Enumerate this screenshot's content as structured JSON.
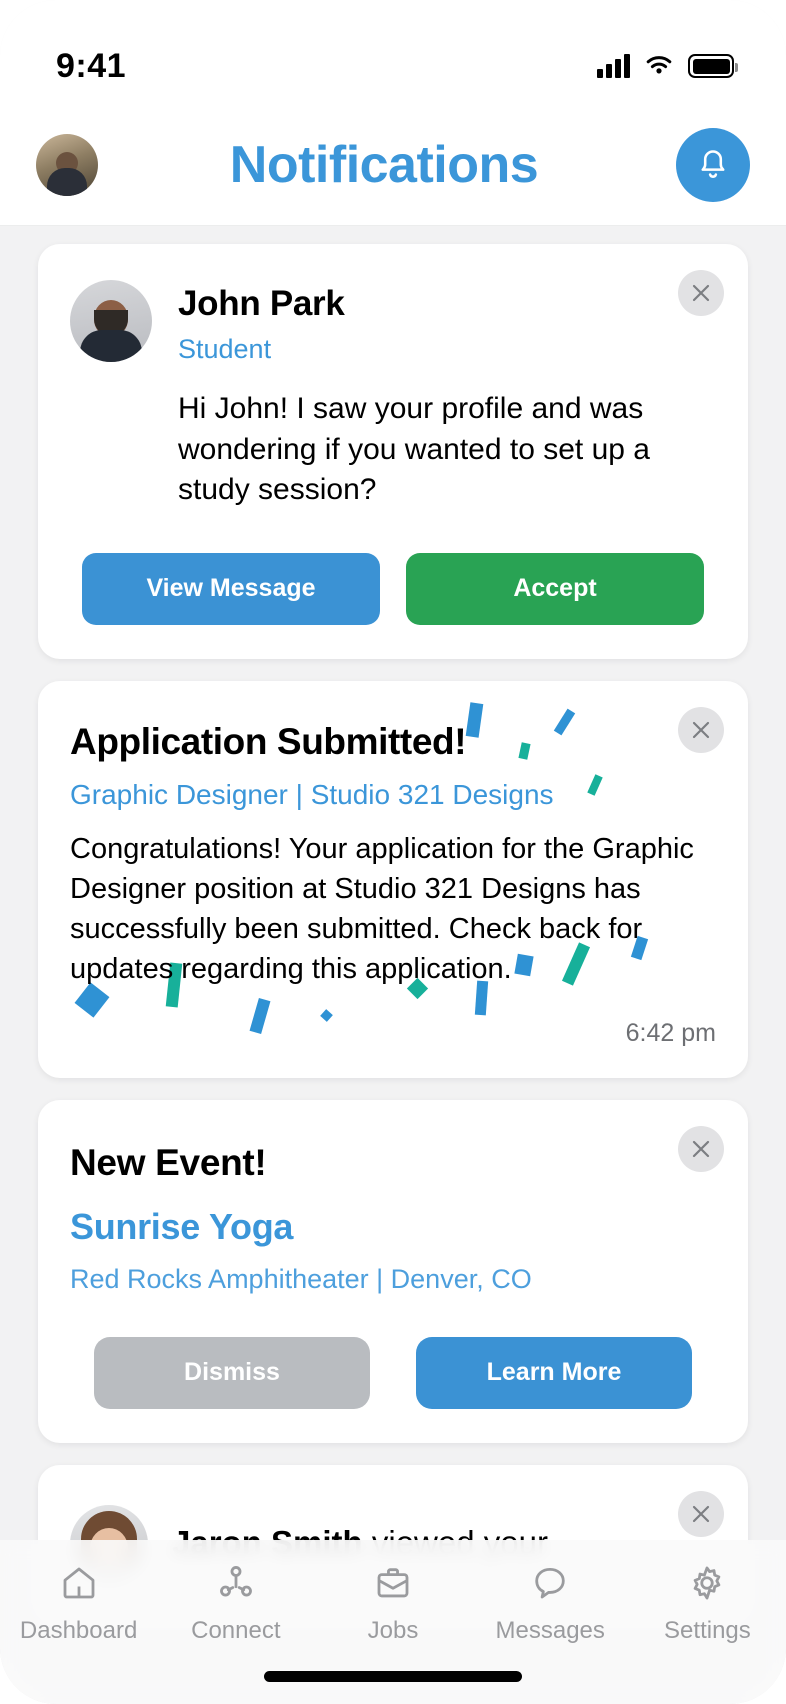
{
  "status_bar": {
    "time": "9:41",
    "signal_icon": "cellular-signal-icon",
    "wifi_icon": "wifi-icon",
    "battery_icon": "battery-full-icon"
  },
  "header": {
    "title": "Notifications",
    "avatar_name": "user-avatar",
    "bell_icon": "bell-icon",
    "title_color": "#3b96d9"
  },
  "cards": {
    "message": {
      "name": "John Park",
      "role": "Student",
      "body": "Hi John! I saw your profile and was wondering if you wanted to set up a study session?",
      "primary_label": "View Message",
      "secondary_label": "Accept",
      "primary_color": "#3b92d4",
      "secondary_color": "#29a354",
      "close_icon": "close-icon"
    },
    "application": {
      "title": "Application Submitted!",
      "subtitle": "Graphic Designer | Studio 321 Designs",
      "body": "Congratulations! Your application for the Graphic Designer position at Studio 321 Designs has successfully been submitted. Check back for updates regarding this application.",
      "time": "6:42 pm",
      "confetti_colors": [
        "#2f92d4",
        "#17b09a"
      ],
      "close_icon": "close-icon"
    },
    "event": {
      "title": "New Event!",
      "name": "Sunrise Yoga",
      "location": "Red Rocks Amphitheater | Denver, CO",
      "dismiss_label": "Dismiss",
      "learn_label": "Learn More",
      "dismiss_color": "#b9bcc0",
      "learn_color": "#3b92d4",
      "close_icon": "close-icon"
    },
    "profile_view": {
      "name": "Jaron Smith",
      "rest": " viewed your",
      "close_icon": "close-icon"
    }
  },
  "tabbar": {
    "items": [
      {
        "label": "Dashboard",
        "icon": "home-icon"
      },
      {
        "label": "Connect",
        "icon": "network-icon"
      },
      {
        "label": "Jobs",
        "icon": "briefcase-icon"
      },
      {
        "label": "Messages",
        "icon": "chat-bubble-icon"
      },
      {
        "label": "Settings",
        "icon": "gear-icon"
      }
    ],
    "inactive_color": "#9a9b9e"
  }
}
